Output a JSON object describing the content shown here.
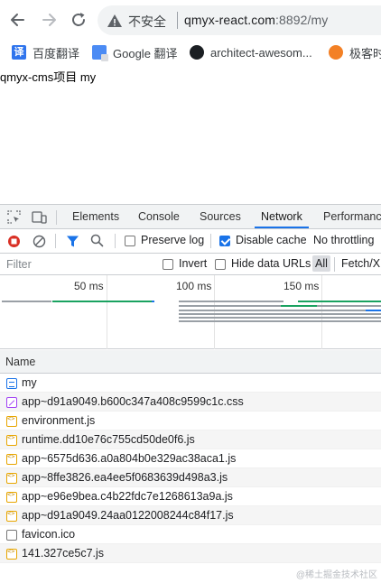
{
  "browser": {
    "security_label": "不安全",
    "url_host": "qmyx-react.com",
    "url_rest": ":8892/my",
    "bookmarks": [
      {
        "label": "百度翻译",
        "icon": "baidu-fanyi-icon"
      },
      {
        "label": "Google 翻译",
        "icon": "google-translate-icon"
      },
      {
        "label": "architect-awesom...",
        "icon": "github-icon"
      },
      {
        "label": "极客时",
        "icon": "geektime-icon"
      }
    ]
  },
  "page": {
    "text": "qmyx-cms项目 my"
  },
  "devtools": {
    "tabs": [
      {
        "label": "Elements"
      },
      {
        "label": "Console"
      },
      {
        "label": "Sources"
      },
      {
        "label": "Network",
        "active": true
      },
      {
        "label": "Performance"
      }
    ],
    "toolbar": {
      "preserve_log": "Preserve log",
      "preserve_log_checked": false,
      "disable_cache": "Disable cache",
      "disable_cache_checked": true,
      "throttling": "No throttling"
    },
    "filter": {
      "placeholder": "Filter",
      "invert": "Invert",
      "hide_data_urls": "Hide data URLs",
      "all": "All",
      "fetch_xhr": "Fetch/XH"
    },
    "timeline": {
      "ticks": [
        "50 ms",
        "100 ms",
        "150 ms"
      ],
      "colors": {
        "waiting": "#1aa260",
        "queued": "#9aa0a6",
        "download": "#1a73e8"
      }
    },
    "requests_header": "Name",
    "requests": [
      {
        "name": "my",
        "type": "doc"
      },
      {
        "name": "app~d91a9049.b600c347a408c9599c1c.css",
        "type": "css"
      },
      {
        "name": "environment.js",
        "type": "js"
      },
      {
        "name": "runtime.dd10e76c755cd50de0f6.js",
        "type": "js"
      },
      {
        "name": "app~6575d636.a0a804b0e329ac38aca1.js",
        "type": "js"
      },
      {
        "name": "app~8ffe3826.ea4ee5f0683639d498a3.js",
        "type": "js"
      },
      {
        "name": "app~e96e9bea.c4b22fdc7e1268613a9a.js",
        "type": "js"
      },
      {
        "name": "app~d91a9049.24aa0122008244c84f17.js",
        "type": "js"
      },
      {
        "name": "favicon.ico",
        "type": "other"
      },
      {
        "name": "141.327ce5c7.js",
        "type": "js"
      }
    ]
  },
  "watermark": "@稀土掘金技术社区"
}
